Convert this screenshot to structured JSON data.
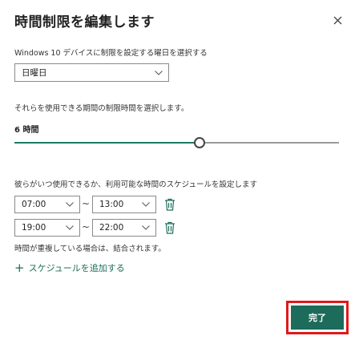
{
  "dialog": {
    "title": "時間制限を編集します",
    "close_icon": "close-icon"
  },
  "day_section": {
    "label": "Windows 10 デバイスに制限を設定する曜日を選択する",
    "selected_day": "日曜日"
  },
  "limit_section": {
    "label": "それらを使用できる期間の制限時間を選択します。",
    "hours_label": "6 時間",
    "slider_value_hours": 6,
    "slider_fill_fraction": 0.57
  },
  "schedule_section": {
    "label": "彼らがいつ使用できるか、利用可能な時間のスケジュールを設定します",
    "separator": "~",
    "rows": [
      {
        "start": "07:00",
        "end": "13:00"
      },
      {
        "start": "19:00",
        "end": "22:00"
      }
    ],
    "overlap_note": "時間が重複している場合は、結合されます。",
    "add_schedule": "スケジュールを追加する"
  },
  "footer": {
    "done_label": "完了"
  },
  "colors": {
    "accent": "#1d6b5a",
    "link": "#1e6e5a",
    "highlight_border": "#e01a1a"
  }
}
